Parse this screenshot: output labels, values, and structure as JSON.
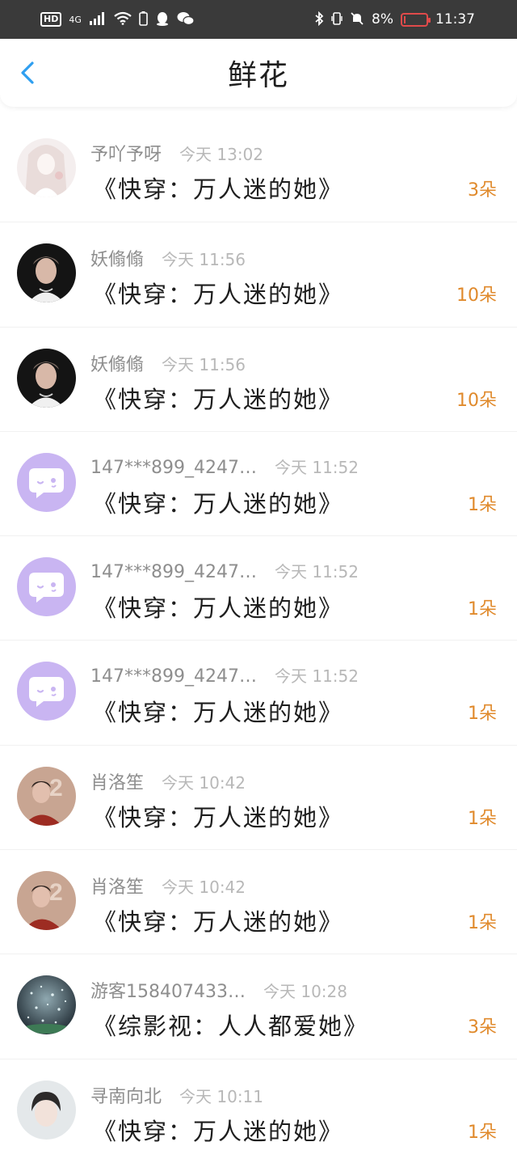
{
  "status_bar": {
    "hd": "HD",
    "network": "4G",
    "battery_percent": "8%",
    "battery_level": 0.08,
    "time": "11:37",
    "left_icons": [
      "hd-icon",
      "signal-icon",
      "wifi-icon",
      "battery-small-icon",
      "qq-icon",
      "wechat-icon"
    ],
    "right_icons": [
      "bluetooth-icon",
      "vibrate-icon",
      "mute-icon"
    ]
  },
  "header": {
    "title": "鲜花",
    "back_icon": "chevron-left-icon"
  },
  "colors": {
    "accent_blue": "#2f9ff0",
    "count_orange": "#e08a2c"
  },
  "records": [
    {
      "user": "予吖予呀",
      "time": "今天 13:02",
      "book": "《快穿：万人迷的她》",
      "count": "3朵",
      "avatar": "girl-white"
    },
    {
      "user": "妖翛翛",
      "time": "今天 11:56",
      "book": "《快穿：万人迷的她》",
      "count": "10朵",
      "avatar": "man-dark"
    },
    {
      "user": "妖翛翛",
      "time": "今天 11:56",
      "book": "《快穿：万人迷的她》",
      "count": "10朵",
      "avatar": "man-dark"
    },
    {
      "user": "147***899_4247…",
      "time": "今天 11:52",
      "book": "《快穿：万人迷的她》",
      "count": "1朵",
      "avatar": "chat-bubble"
    },
    {
      "user": "147***899_4247…",
      "time": "今天 11:52",
      "book": "《快穿：万人迷的她》",
      "count": "1朵",
      "avatar": "chat-bubble"
    },
    {
      "user": "147***899_4247…",
      "time": "今天 11:52",
      "book": "《快穿：万人迷的她》",
      "count": "1朵",
      "avatar": "chat-bubble"
    },
    {
      "user": "肖洛笙",
      "time": "今天 10:42",
      "book": "《快穿：万人迷的她》",
      "count": "1朵",
      "avatar": "man-red"
    },
    {
      "user": "肖洛笙",
      "time": "今天 10:42",
      "book": "《快穿：万人迷的她》",
      "count": "1朵",
      "avatar": "man-red"
    },
    {
      "user": "游客158407433…",
      "time": "今天 10:28",
      "book": "《综影视：人人都爱她》",
      "count": "3朵",
      "avatar": "sparkle"
    },
    {
      "user": "寻南向北",
      "time": "今天 10:11",
      "book": "《快穿：万人迷的她》",
      "count": "1朵",
      "avatar": "boy-light"
    }
  ]
}
